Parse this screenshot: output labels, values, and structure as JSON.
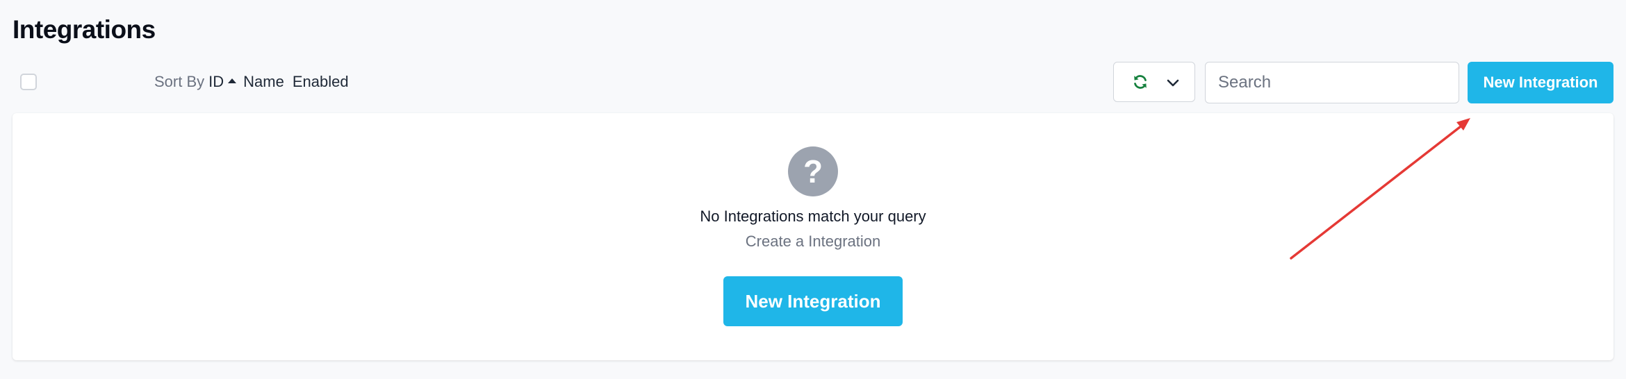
{
  "page": {
    "title": "Integrations"
  },
  "toolbar": {
    "sort_by_label": "Sort By",
    "sort_fields": [
      {
        "label": "ID",
        "active": true,
        "direction": "ascending"
      },
      {
        "label": "Name",
        "active": false
      },
      {
        "label": "Enabled",
        "active": false
      }
    ],
    "refresh_icon": "refresh-icon",
    "dropdown_icon": "chevron-down-icon",
    "search": {
      "placeholder": "Search",
      "value": ""
    },
    "new_button_label": "New Integration"
  },
  "empty_state": {
    "icon": "question-icon",
    "icon_glyph": "?",
    "title": "No Integrations match your query",
    "subtitle": "Create a Integration",
    "button_label": "New Integration"
  },
  "colors": {
    "accent": "#1fb6e8",
    "refresh_icon": "#15803d",
    "annotation_arrow": "#e53935",
    "empty_icon_bg": "#9ca3af"
  }
}
